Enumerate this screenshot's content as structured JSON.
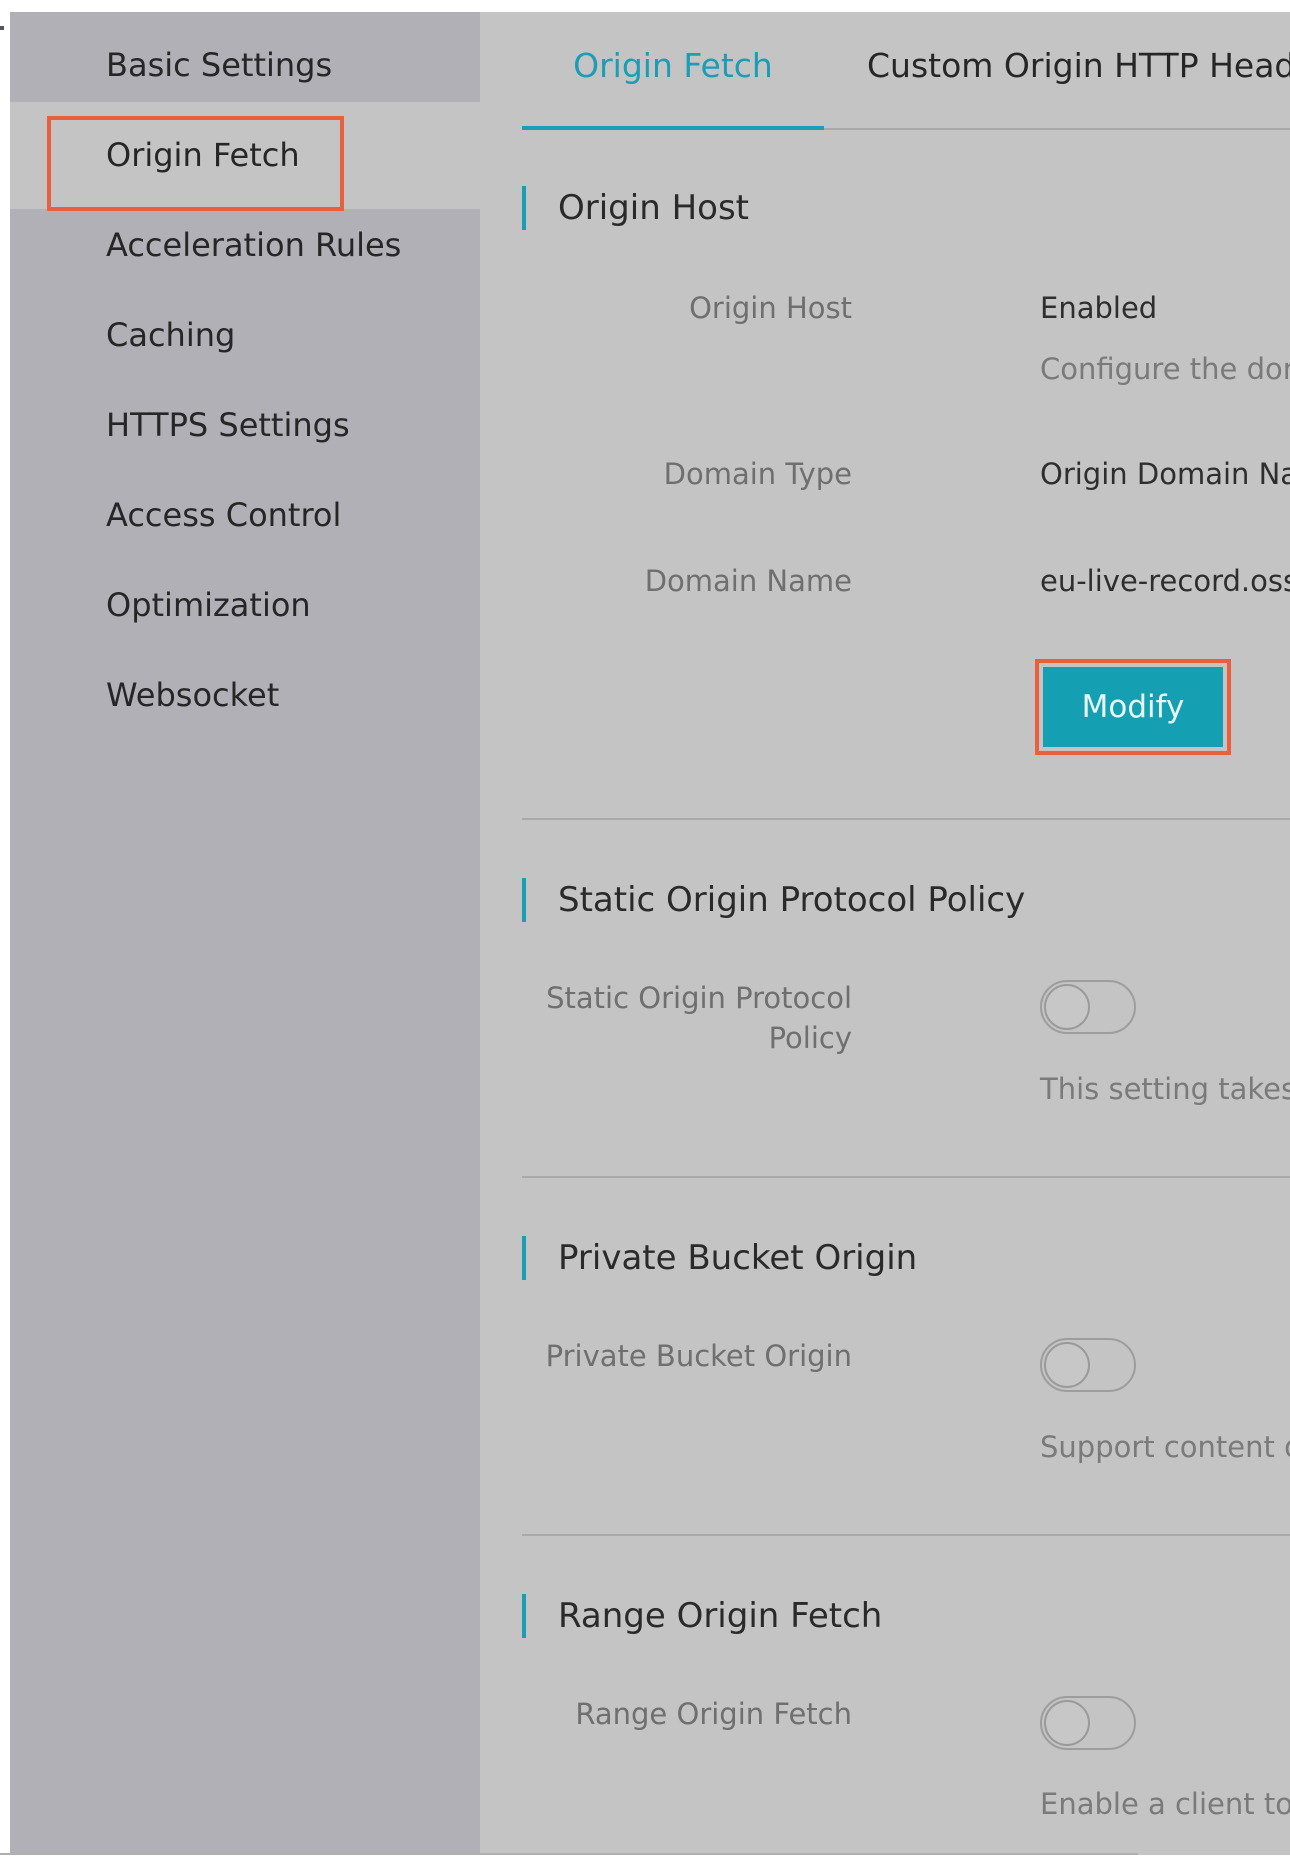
{
  "sidebar": {
    "items": [
      {
        "label": "Basic Settings"
      },
      {
        "label": "Origin Fetch"
      },
      {
        "label": "Acceleration Rules"
      },
      {
        "label": "Caching"
      },
      {
        "label": "HTTPS Settings"
      },
      {
        "label": "Access Control"
      },
      {
        "label": "Optimization"
      },
      {
        "label": "Websocket"
      }
    ],
    "active": "Origin Fetch"
  },
  "tabs": [
    {
      "label": "Origin Fetch",
      "active": true
    },
    {
      "label": "Custom Origin HTTP Head"
    }
  ],
  "sections": {
    "origin_host": {
      "title": "Origin Host",
      "fields": [
        {
          "label": "Origin Host",
          "value": "Enabled",
          "hint": "Configure the dom"
        },
        {
          "label": "Domain Type",
          "value": "Origin Domain Nam"
        },
        {
          "label": "Domain Name",
          "value": "eu-live-record.oss-e"
        }
      ],
      "modify_label": "Modify"
    },
    "static_origin": {
      "title": "Static Origin Protocol Policy",
      "label_line1": "Static Origin Protocol",
      "label_line2": "Policy",
      "enabled": false,
      "hint": "This setting takes e"
    },
    "private_bucket": {
      "title": "Private Bucket Origin",
      "label": "Private Bucket Origin",
      "enabled": false,
      "hint": "Support content de"
    },
    "range_origin": {
      "title": "Range Origin Fetch",
      "label": "Range Origin Fetch",
      "enabled": false,
      "hint": "Enable a client to n"
    }
  },
  "colors": {
    "accent": "#1a9db5",
    "highlight": "#e8603c",
    "sidebar_bg": "#b1b0b6",
    "content_bg": "#c4c4c4"
  }
}
